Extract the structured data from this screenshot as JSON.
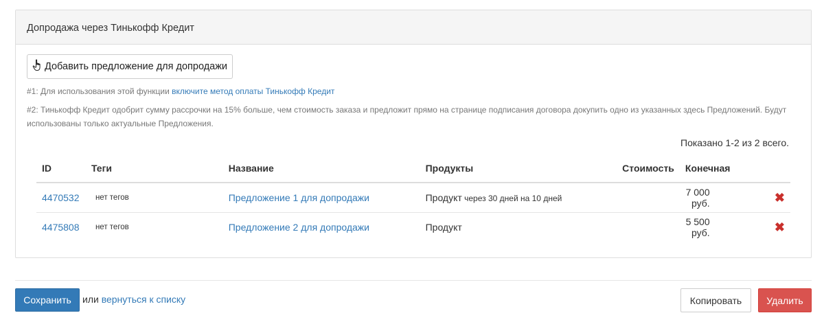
{
  "panel": {
    "title": "Допродажа через Тинькофф Кредит",
    "add_button_label": "Добавить предложение для допродажи",
    "note1_prefix": "#1: Для использования этой функции ",
    "note1_link": "включите метод оплаты Тинькофф Кредит",
    "note2": "#2: Тинькофф Кредит одобрит сумму рассрочки на 15% больше, чем стоимость заказа и предложит прямо на странице подписания договора докупить одно из указанных здесь Предложений. Будут использованы только актуальные Предложения."
  },
  "table": {
    "summary": "Показано 1-2 из 2 всего.",
    "columns": {
      "id": "ID",
      "tags": "Теги",
      "name": "Название",
      "products": "Продукты",
      "cost": "Стоимость",
      "final": "Конечная"
    },
    "rows": [
      {
        "id": "4470532",
        "tags": "нет тегов",
        "name": "Предложение 1 для допродажи",
        "product": "Продукт",
        "product_extra": " через 30 дней на 10 дней",
        "final": "7 000 руб."
      },
      {
        "id": "4475808",
        "tags": "нет тегов",
        "name": "Предложение 2 для допродажи",
        "product": "Продукт",
        "product_extra": "",
        "final": "5 500 руб."
      }
    ],
    "delete_icon": "close-icon",
    "delete_color": "#c9302c"
  },
  "footer": {
    "save_label": "Сохранить",
    "or_text": "или ",
    "back_link": "вернуться к списку",
    "copy_label": "Копировать",
    "delete_label": "Удалить"
  },
  "colors": {
    "primary": "#337ab7",
    "danger": "#d9534f",
    "panel_head_bg": "#f5f5f5"
  }
}
